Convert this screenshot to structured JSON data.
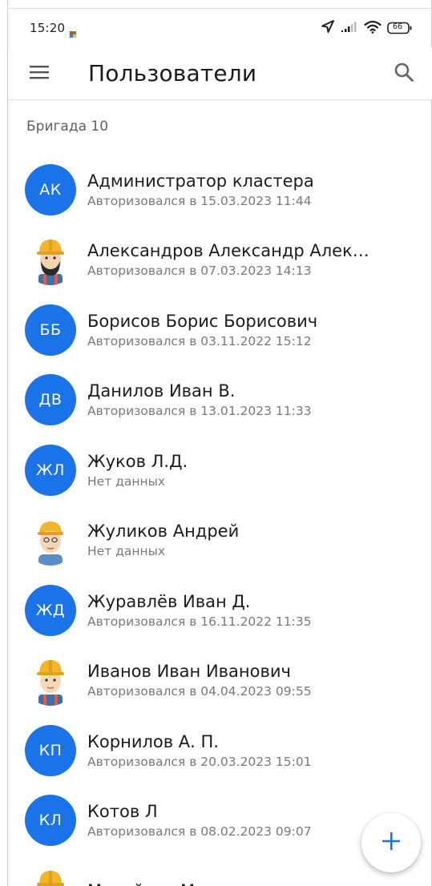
{
  "status_bar": {
    "time": "15:20",
    "battery": "66",
    "icons": [
      "notification-icon",
      "location-arrow-icon",
      "cell-signal-icon",
      "wifi-icon",
      "battery-icon"
    ]
  },
  "app_bar": {
    "title": "Пользователи",
    "menu_icon": "hamburger-menu-icon",
    "search_icon": "search-icon"
  },
  "section": {
    "header": "Бригада 10"
  },
  "users": [
    {
      "name": "Администратор кластера",
      "status": "Авторизовался в 15.03.2023 11:44",
      "avatar_type": "initials",
      "initials": "АК"
    },
    {
      "name": "Александров Александр Алек…",
      "status": "Авторизовался в 07.03.2023 14:13",
      "avatar_type": "photo",
      "avatar_icon": "bearded-worker-helmet-avatar"
    },
    {
      "name": "Борисов Борис Борисович",
      "status": "Авторизовался в 03.11.2022 15:12",
      "avatar_type": "initials",
      "initials": "ББ"
    },
    {
      "name": "Данилов Иван В.",
      "status": "Авторизовался в 13.01.2023 11:33",
      "avatar_type": "initials",
      "initials": "ДВ"
    },
    {
      "name": "Жуков Л.Д.",
      "status": "Нет данных",
      "avatar_type": "initials",
      "initials": "ЖЛ"
    },
    {
      "name": "Жуликов Андрей",
      "status": "Нет данных",
      "avatar_type": "photo",
      "avatar_icon": "young-man-cap-avatar"
    },
    {
      "name": "Журавлёв Иван Д.",
      "status": "Авторизовался в 16.11.2022 11:35",
      "avatar_type": "initials",
      "initials": "ЖД"
    },
    {
      "name": "Иванов Иван Иванович",
      "status": "Авторизовался в 04.04.2023 09:55",
      "avatar_type": "photo",
      "avatar_icon": "worker-helmet-avatar"
    },
    {
      "name": "Корнилов А. П.",
      "status": "Авторизовался в 20.03.2023 15:01",
      "avatar_type": "initials",
      "initials": "КП"
    },
    {
      "name": "Котов Л",
      "status": "Авторизовался в 08.02.2023 09:07",
      "avatar_type": "initials",
      "initials": "КЛ"
    },
    {
      "name": "Михайлов Михаил",
      "status": "",
      "avatar_type": "photo",
      "avatar_icon": "worker-helmet-avatar"
    }
  ],
  "fab": {
    "icon": "plus-icon"
  },
  "colors": {
    "accent": "#1a73e8",
    "helmet": "#f2b62a"
  }
}
